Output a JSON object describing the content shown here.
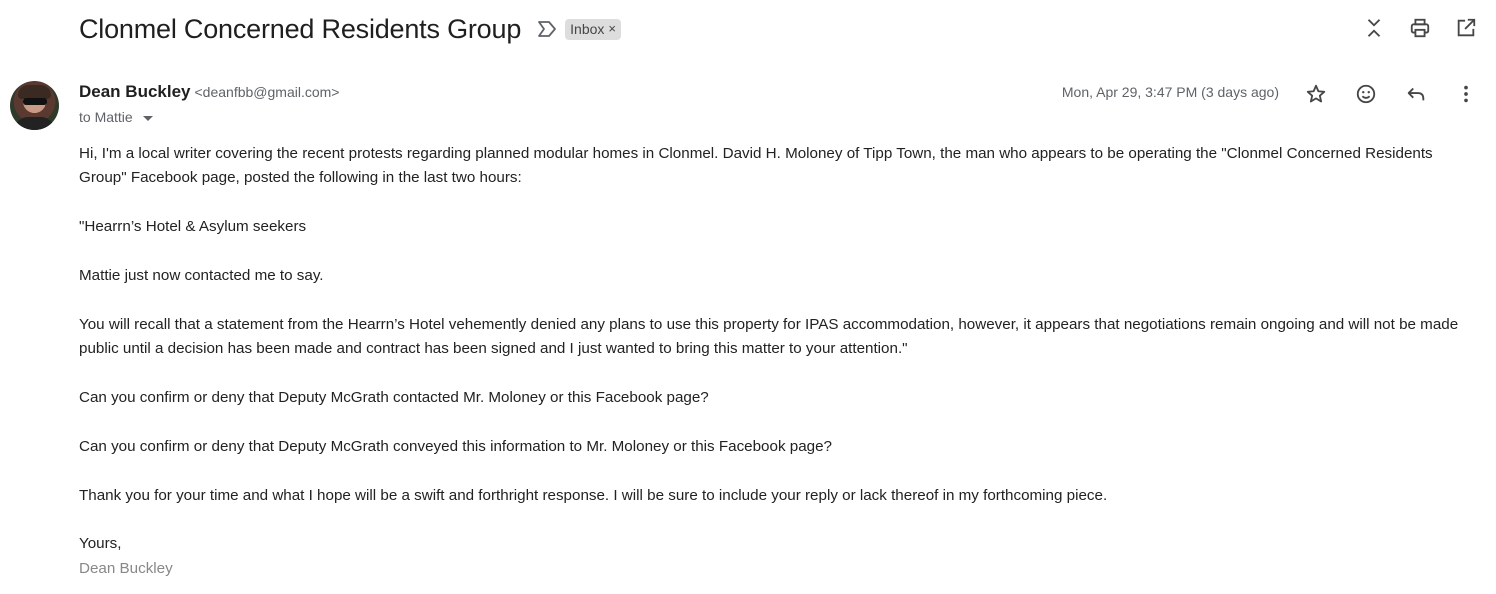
{
  "thread": {
    "subject": "Clonmel Concerned Residents Group",
    "label": "Inbox",
    "label_close": "×"
  },
  "top_actions": {
    "icons": [
      "collapse-all-icon",
      "print-icon",
      "open-in-new-window-icon"
    ]
  },
  "message": {
    "sender_name": "Dean Buckley",
    "sender_email": "<deanfbb@gmail.com>",
    "to": "to Mattie",
    "date": "Mon, Apr 29, 3:47 PM (3 days ago)",
    "action_icons": [
      "star-icon",
      "emoji-icon",
      "reply-icon",
      "more-vert-icon"
    ],
    "body": {
      "p1": "Hi, I'm a local writer covering the recent protests regarding planned modular homes in Clonmel. David H. Moloney of Tipp Town, the man who appears to be operating the \"Clonmel Concerned Residents Group\" Facebook page, posted the following in the last two hours:",
      "p2": "\"Hearrn’s Hotel & Asylum seekers",
      "p3": "Mattie just now contacted me to say.",
      "p4": "You will recall that a statement from the Hearrn’s Hotel vehemently denied any plans to use this property for IPAS accommodation, however, it appears that negotiations remain ongoing and will not be made public until a decision has been made and contract has been signed and I just wanted to bring this matter to your attention.\"",
      "p5": "Can you confirm or deny that Deputy McGrath contacted Mr. Moloney or this Facebook page?",
      "p6": "Can you confirm or deny that Deputy McGrath conveyed this information to Mr. Moloney or this Facebook page?",
      "p7": "Thank you for your time and what I hope will be a swift and forthright response. I will be sure to include your reply or lack thereof in my forthcoming piece.",
      "closing": "Yours,",
      "signature": "Dean Buckley"
    }
  },
  "colors": {
    "text": "#222222",
    "muted": "#5f6368",
    "chip_bg": "#dddddd",
    "signature": "#888888"
  }
}
